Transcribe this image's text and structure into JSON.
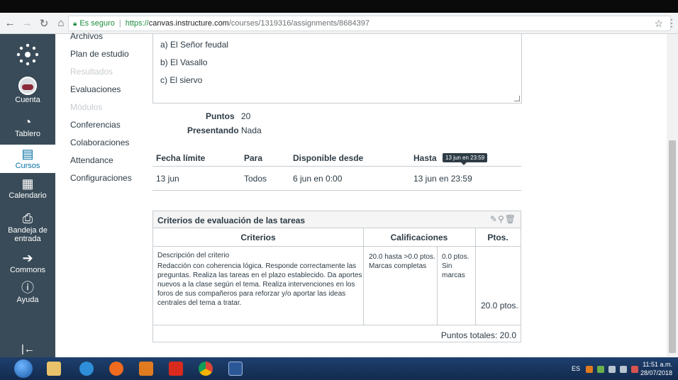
{
  "browser": {
    "secure_label": "Es seguro",
    "url_scheme": "https://",
    "url_host": "canvas.instructure.com",
    "url_path": "/courses/1319316/assignments/8684397"
  },
  "global_nav": {
    "items": [
      {
        "label": "Cuenta"
      },
      {
        "label": "Tablero"
      },
      {
        "label": "Cursos"
      },
      {
        "label": "Calendario"
      },
      {
        "label": "Bandeja de entrada"
      },
      {
        "label": "Commons"
      },
      {
        "label": "Ayuda"
      }
    ]
  },
  "course_nav": {
    "items": [
      {
        "label": "Archivos"
      },
      {
        "label": "Plan de estudio"
      },
      {
        "label": "Resultados"
      },
      {
        "label": "Evaluaciones"
      },
      {
        "label": "Módulos"
      },
      {
        "label": "Conferencias"
      },
      {
        "label": "Colaboraciones"
      },
      {
        "label": "Attendance"
      },
      {
        "label": "Configuraciones"
      }
    ]
  },
  "answers": [
    "a) El Señor feudal",
    "b) El Vasallo",
    "c) El siervo"
  ],
  "points": {
    "label": "Puntos",
    "value": "20"
  },
  "submitting": {
    "label": "Presentando",
    "value": "Nada"
  },
  "due": {
    "headers": {
      "due": "Fecha límite",
      "for": "Para",
      "available": "Disponible desde",
      "until": "Hasta"
    },
    "row": {
      "due": "13 jun",
      "for": "Todos",
      "available": "6 jun en 0:00",
      "until": "13 jun en 23:59"
    },
    "tooltip": "13 jun en 23:59"
  },
  "rubric": {
    "title": "Criterios de evaluación de las tareas",
    "headers": {
      "criteria": "Criterios",
      "ratings": "Calificaciones",
      "pts": "Ptos."
    },
    "criterion_title": "Descripción del criterio",
    "criterion_desc": "Redacción con coherencia lógica. Responde correctamente las preguntas. Realiza las tareas en el plazo establecido. Da aportes nuevos a la clase según el tema. Realiza intervenciones en los foros de sus compañeros para reforzar y/o aportar las ideas centrales del tema a tratar.",
    "rating1_pts": "20.0 hasta >0.0 ptos.",
    "rating1_desc": "Marcas completas",
    "rating2_pts": "0.0 ptos.",
    "rating2_desc": "Sin marcas",
    "criterion_pts": "20.0 ptos.",
    "total": "Puntos totales: 20.0"
  },
  "taskbar": {
    "lang": "ES",
    "time": "11:51 a.m.",
    "date": "28/07/2018"
  }
}
